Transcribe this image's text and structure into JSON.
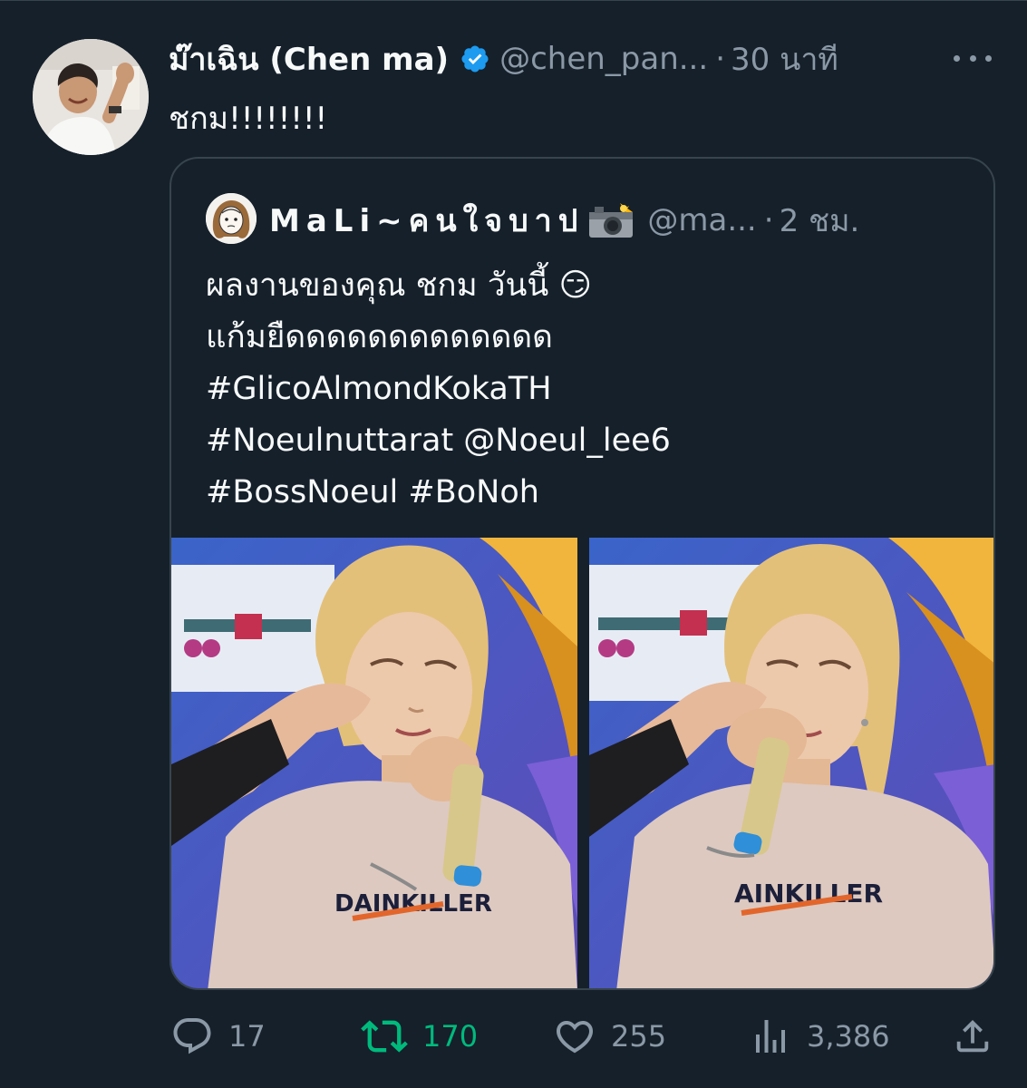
{
  "tweet": {
    "display_name": "ม๊าเฉิน (Chen ma)",
    "handle": "@chen_pan...",
    "dot": "·",
    "time": "30 นาที",
    "text": "ชกม!!!!!!!!"
  },
  "quote": {
    "display_name": "MaLi~คนใจบาป",
    "handle": "@ma...",
    "dot": "·",
    "time": "2 ชม.",
    "lines": [
      "ผลงานของคุณ ชกม วันนี้ 😏",
      "แก้มยืดดดดดดดดดดดดด",
      "#GlicoAlmondKokaTH",
      "#Noeulnuttarat @Noeul_lee6",
      "#BossNoeul #BoNoh"
    ],
    "photos": [
      {
        "shirt_text": "DAINKILLER"
      },
      {
        "shirt_text": "AINKILLER"
      }
    ]
  },
  "actions": {
    "replies": "17",
    "retweets": "170",
    "likes": "255",
    "views": "3,386"
  },
  "colors": {
    "background": "#15202b",
    "text": "#f7f9f9",
    "secondary": "#8b98a5",
    "border": "#38444d",
    "verified": "#1d9bf0",
    "retweet_active": "#00ba7c"
  },
  "icons": [
    "verified-badge-icon",
    "more-icon",
    "camera-flash-emoji",
    "reply-icon",
    "retweet-icon",
    "like-icon",
    "views-icon",
    "share-icon"
  ]
}
